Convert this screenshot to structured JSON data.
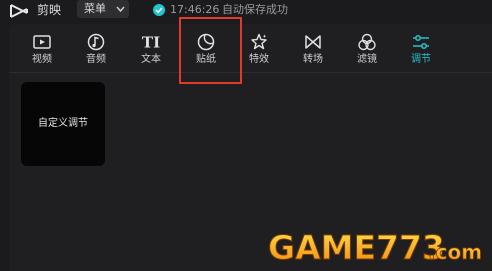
{
  "app": {
    "name": "剪映"
  },
  "menu": {
    "label": "菜单"
  },
  "save_status": {
    "time": "17:46:26",
    "text": "自动保存成功",
    "color": "#22c4d0"
  },
  "tabs": [
    {
      "label": "视频",
      "icon": "video-icon"
    },
    {
      "label": "音频",
      "icon": "audio-icon"
    },
    {
      "label": "文本",
      "icon": "text-icon"
    },
    {
      "label": "贴纸",
      "icon": "sticker-icon",
      "highlighted": true
    },
    {
      "label": "特效",
      "icon": "effects-icon"
    },
    {
      "label": "转场",
      "icon": "transition-icon"
    },
    {
      "label": "滤镜",
      "icon": "filter-icon"
    },
    {
      "label": "调节",
      "icon": "adjust-icon",
      "active": true
    }
  ],
  "preset": {
    "label": "自定义调节"
  },
  "watermark": {
    "text": "GAME773.com"
  },
  "colors": {
    "accent": "#22c4d0",
    "highlight_box": "#e03a2c",
    "background": "#1b1b1d"
  }
}
